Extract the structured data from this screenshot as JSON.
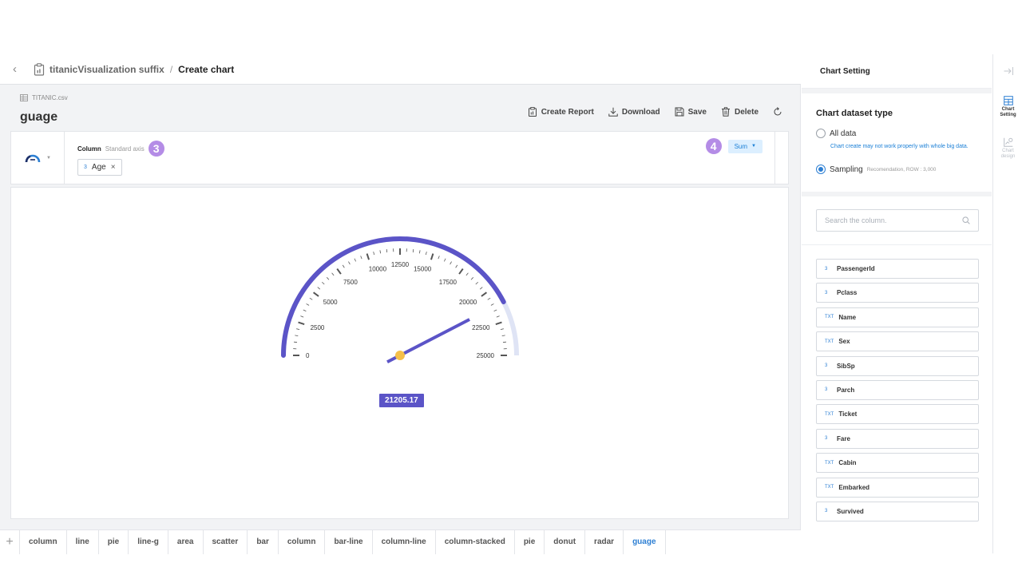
{
  "header": {
    "project_name": "titanicVisualization suffix",
    "separator": "/",
    "page_name": "Create chart"
  },
  "file": {
    "name": "TITANIC.csv"
  },
  "chart": {
    "title": "guage"
  },
  "actions": {
    "create_report": "Create Report",
    "download": "Download",
    "save": "Save",
    "delete": "Delete"
  },
  "axis_panel": {
    "column_label": "Column",
    "column_sub": "Standard axis",
    "step_badge": "3",
    "chip_type": "3",
    "chip_label": "Age",
    "chip_remove": "×",
    "agg_badge": "4",
    "agg_value": "Sum"
  },
  "chart_data": {
    "type": "gauge",
    "min": 0,
    "max": 25000,
    "value": 21205.17,
    "value_label": "21205.17",
    "tick_labels": [
      "0",
      "2500",
      "5000",
      "7500",
      "10000",
      "12500",
      "15000",
      "17500",
      "20000",
      "22500",
      "25000"
    ],
    "major_step": 2500,
    "minor_per_major": 5,
    "colors": {
      "arc_filled": "#5b54c7",
      "arc_empty": "#dfe4f5",
      "needle": "#5b54c7",
      "pivot": "#f5c04a",
      "ticks": "#555555"
    }
  },
  "tabs": {
    "add": "+",
    "items": [
      "column",
      "line",
      "pie",
      "line-g",
      "area",
      "scatter",
      "bar",
      "column",
      "bar-line",
      "column-line",
      "column-stacked",
      "pie",
      "donut",
      "radar",
      "guage"
    ],
    "active_index": 14
  },
  "settings": {
    "title": "Chart Setting",
    "dataset_title": "Chart dataset type",
    "option_all": "All data",
    "option_all_warning": "Chart create may not work properly with whole big data.",
    "option_sampling": "Sampling",
    "option_sampling_sub": "Recomendation, ROW : 3,000",
    "selected_option": "sampling",
    "search_placeholder": "Search the column.",
    "columns": [
      {
        "type": "3",
        "name": "PassengerId"
      },
      {
        "type": "3",
        "name": "Pclass"
      },
      {
        "type": "TXT",
        "name": "Name"
      },
      {
        "type": "TXT",
        "name": "Sex"
      },
      {
        "type": "3",
        "name": "SibSp"
      },
      {
        "type": "3",
        "name": "Parch"
      },
      {
        "type": "TXT",
        "name": "Ticket"
      },
      {
        "type": "3",
        "name": "Fare"
      },
      {
        "type": "TXT",
        "name": "Cabin"
      },
      {
        "type": "TXT",
        "name": "Embarked"
      },
      {
        "type": "3",
        "name": "Survived"
      }
    ]
  },
  "rail": {
    "chart_setting": "Chart Setting",
    "chart_design": "Chart design"
  }
}
